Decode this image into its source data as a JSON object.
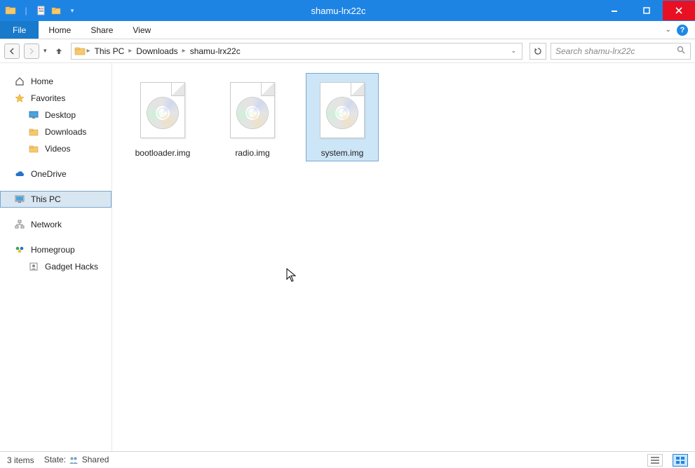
{
  "window": {
    "title": "shamu-lrx22c"
  },
  "ribbon": {
    "file": "File",
    "tabs": [
      "Home",
      "Share",
      "View"
    ]
  },
  "breadcrumb": {
    "parts": [
      "This PC",
      "Downloads",
      "shamu-lrx22c"
    ]
  },
  "search": {
    "placeholder": "Search shamu-lrx22c"
  },
  "sidebar": {
    "home": "Home",
    "favorites": "Favorites",
    "favorites_children": [
      "Desktop",
      "Downloads",
      "Videos"
    ],
    "onedrive": "OneDrive",
    "thispc": "This PC",
    "network": "Network",
    "homegroup": "Homegroup",
    "homegroup_children": [
      "Gadget Hacks"
    ]
  },
  "files": [
    {
      "name": "bootloader.img",
      "selected": false
    },
    {
      "name": "radio.img",
      "selected": false
    },
    {
      "name": "system.img",
      "selected": true
    }
  ],
  "status": {
    "count": "3 items",
    "state_label": "State:",
    "state_value": "Shared"
  }
}
